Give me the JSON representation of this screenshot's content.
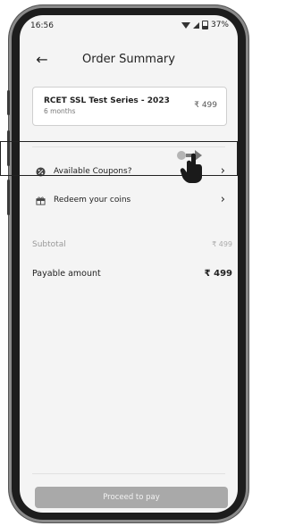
{
  "status_bar": {
    "time": "16:56",
    "battery": "37%"
  },
  "header": {
    "title": "Order Summary"
  },
  "course": {
    "name": "RCET SSL Test Series - 2023",
    "duration": "6 months",
    "price": "₹ 499"
  },
  "options": [
    {
      "label": "Available Coupons?",
      "icon": "coupon-icon"
    },
    {
      "label": "Redeem your coins",
      "icon": "gift-icon"
    }
  ],
  "summary": {
    "subtotal_label": "Subtotal",
    "subtotal_value": "₹ 499",
    "payable_label": "Payable amount",
    "payable_value": "₹ 499"
  },
  "cta": {
    "label": "Proceed to pay"
  }
}
